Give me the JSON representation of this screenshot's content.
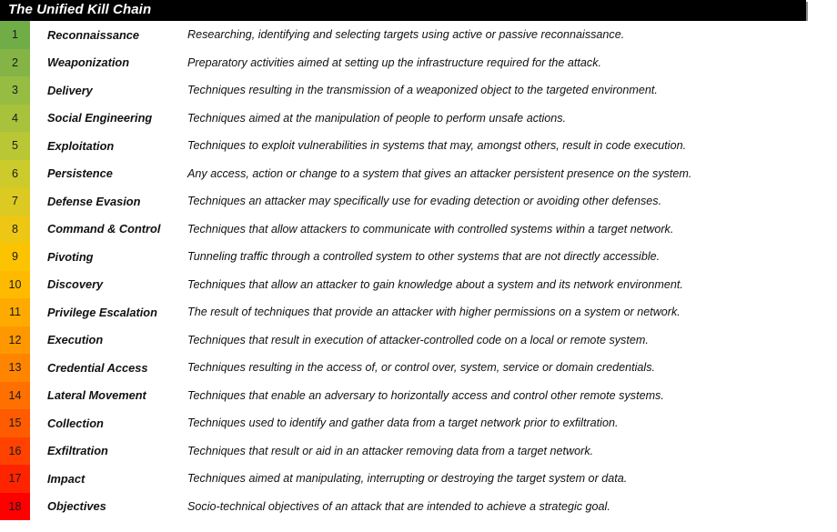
{
  "header": {
    "title": "The Unified Kill Chain"
  },
  "colors": {
    "header_background": "#000000",
    "header_text": "#ffffff",
    "page_background": "#ffffff",
    "body_text": "#111111",
    "gradient_start": "#70AD47",
    "gradient_mid": "#FFC000",
    "gradient_end": "#FF0000"
  },
  "phases": [
    {
      "number": "1",
      "name": "Reconnaissance",
      "description": "Researching, identifying and selecting targets using active or passive reconnaissance.",
      "color": "#70AD47"
    },
    {
      "number": "2",
      "name": "Weaponization",
      "description": "Preparatory activities aimed at setting up the infrastructure required for the attack.",
      "color": "#84B446"
    },
    {
      "number": "3",
      "name": "Delivery",
      "description": "Techniques resulting in the transmission of a weaponized object to the targeted environment.",
      "color": "#96BC42"
    },
    {
      "number": "4",
      "name": "Social Engineering",
      "description": "Techniques aimed at the manipulation of people to perform unsafe actions.",
      "color": "#A8C23C"
    },
    {
      "number": "5",
      "name": "Exploitation",
      "description": "Techniques to exploit vulnerabilities in systems that may, amongst others, result in code execution.",
      "color": "#BAC734"
    },
    {
      "number": "6",
      "name": "Persistence",
      "description": "Any access, action or change to a system that gives an attacker persistent presence on the system.",
      "color": "#CCCB2B"
    },
    {
      "number": "7",
      "name": "Defense Evasion",
      "description": "Techniques an attacker may specifically use for evading detection or avoiding other defenses.",
      "color": "#DCC922"
    },
    {
      "number": "8",
      "name": "Command & Control",
      "description": "Techniques that allow attackers to communicate with controlled systems within a target network.",
      "color": "#EDC713"
    },
    {
      "number": "9",
      "name": "Pivoting",
      "description": "Tunneling traffic through a controlled system to other systems that are not directly accessible.",
      "color": "#FCC400"
    },
    {
      "number": "10",
      "name": "Discovery",
      "description": "Techniques that allow an attacker to gain knowledge about a system and its network environment.",
      "color": "#FFBA00"
    },
    {
      "number": "11",
      "name": "Privilege Escalation",
      "description": "The result of techniques that provide an attacker with higher permissions on a system or network.",
      "color": "#FFAA00"
    },
    {
      "number": "12",
      "name": "Execution",
      "description": "Techniques that result in execution of attacker-controlled code on a local or remote system.",
      "color": "#FF9800"
    },
    {
      "number": "13",
      "name": "Credential Access",
      "description": "Techniques resulting in the access of, or control over, system, service or domain credentials.",
      "color": "#FF8400"
    },
    {
      "number": "14",
      "name": "Lateral Movement",
      "description": "Techniques that enable an adversary to horizontally access and control other remote systems.",
      "color": "#FF7000"
    },
    {
      "number": "15",
      "name": "Collection",
      "description": "Techniques used to identify and gather data from a target network prior to exfiltration.",
      "color": "#FF5B00"
    },
    {
      "number": "16",
      "name": "Exfiltration",
      "description": "Techniques that result or aid in an attacker removing data from a target network.",
      "color": "#FF4200"
    },
    {
      "number": "17",
      "name": "Impact",
      "description": "Techniques aimed at manipulating, interrupting or destroying the target system or data.",
      "color": "#FF2400"
    },
    {
      "number": "18",
      "name": "Objectives",
      "description": "Socio-technical objectives of an attack that are intended to achieve a strategic goal.",
      "color": "#FF0000"
    }
  ]
}
